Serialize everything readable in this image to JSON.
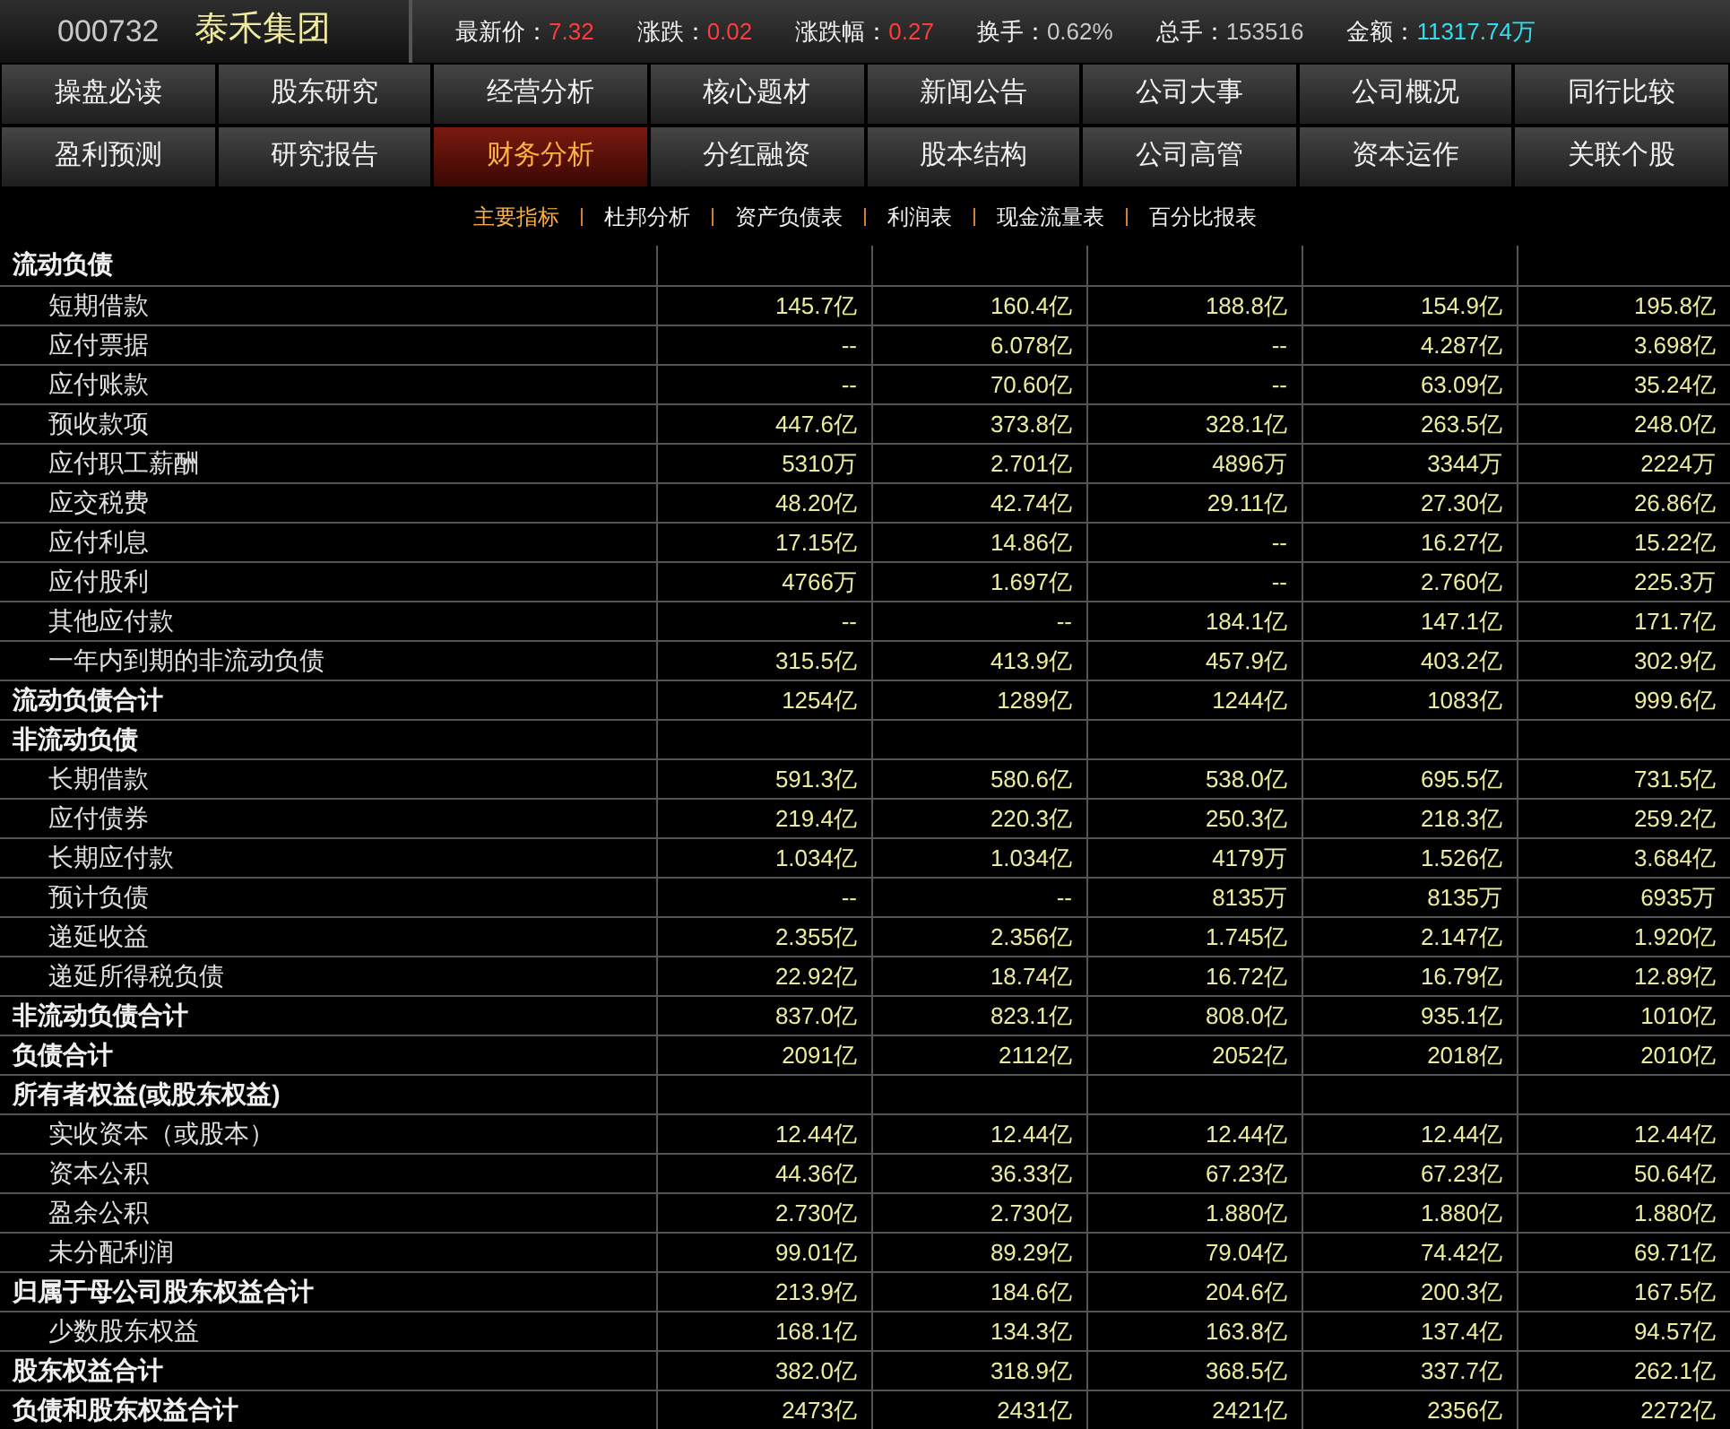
{
  "header": {
    "code": "000732",
    "name": "泰禾集团",
    "stats": [
      {
        "label": "最新价：",
        "value": "7.32",
        "color": "#ff3b3b"
      },
      {
        "label": "涨跌：",
        "value": "0.02",
        "color": "#ff3b3b"
      },
      {
        "label": "涨跌幅：",
        "value": "0.27",
        "color": "#ff3b3b"
      },
      {
        "label": "换手：",
        "value": "0.62%",
        "color": "#c8c8c8"
      },
      {
        "label": "总手：",
        "value": "153516",
        "color": "#c8c8c8"
      },
      {
        "label": "金额：",
        "value": "11317.74万",
        "color": "#33ddee"
      }
    ]
  },
  "nav_rows": [
    [
      {
        "label": "操盘必读",
        "selected": false
      },
      {
        "label": "股东研究",
        "selected": false
      },
      {
        "label": "经营分析",
        "selected": false
      },
      {
        "label": "核心题材",
        "selected": false
      },
      {
        "label": "新闻公告",
        "selected": false
      },
      {
        "label": "公司大事",
        "selected": false
      },
      {
        "label": "公司概况",
        "selected": false
      },
      {
        "label": "同行比较",
        "selected": false
      }
    ],
    [
      {
        "label": "盈利预测",
        "selected": false
      },
      {
        "label": "研究报告",
        "selected": false
      },
      {
        "label": "财务分析",
        "selected": true
      },
      {
        "label": "分红融资",
        "selected": false
      },
      {
        "label": "股本结构",
        "selected": false
      },
      {
        "label": "公司高管",
        "selected": false
      },
      {
        "label": "资本运作",
        "selected": false
      },
      {
        "label": "关联个股",
        "selected": false
      }
    ]
  ],
  "sub_tabs": [
    {
      "label": "主要指标",
      "selected": true
    },
    {
      "label": "杜邦分析",
      "selected": false
    },
    {
      "label": "资产负债表",
      "selected": false
    },
    {
      "label": "利润表",
      "selected": false
    },
    {
      "label": "现金流量表",
      "selected": false
    },
    {
      "label": "百分比报表",
      "selected": false
    }
  ],
  "table": {
    "rows": [
      {
        "kind": "section",
        "label": "流动负债"
      },
      {
        "kind": "item",
        "label": "短期借款",
        "values": [
          "145.7亿",
          "160.4亿",
          "188.8亿",
          "154.9亿",
          "195.8亿"
        ]
      },
      {
        "kind": "item",
        "label": "应付票据",
        "values": [
          "--",
          "6.078亿",
          "--",
          "4.287亿",
          "3.698亿"
        ]
      },
      {
        "kind": "item",
        "label": "应付账款",
        "values": [
          "--",
          "70.60亿",
          "--",
          "63.09亿",
          "35.24亿"
        ]
      },
      {
        "kind": "item",
        "label": "预收款项",
        "values": [
          "447.6亿",
          "373.8亿",
          "328.1亿",
          "263.5亿",
          "248.0亿"
        ]
      },
      {
        "kind": "item",
        "label": "应付职工薪酬",
        "values": [
          "5310万",
          "2.701亿",
          "4896万",
          "3344万",
          "2224万"
        ]
      },
      {
        "kind": "item",
        "label": "应交税费",
        "values": [
          "48.20亿",
          "42.74亿",
          "29.11亿",
          "27.30亿",
          "26.86亿"
        ]
      },
      {
        "kind": "item",
        "label": "应付利息",
        "values": [
          "17.15亿",
          "14.86亿",
          "--",
          "16.27亿",
          "15.22亿"
        ]
      },
      {
        "kind": "item",
        "label": "应付股利",
        "values": [
          "4766万",
          "1.697亿",
          "--",
          "2.760亿",
          "225.3万"
        ]
      },
      {
        "kind": "item",
        "label": "其他应付款",
        "values": [
          "--",
          "--",
          "184.1亿",
          "147.1亿",
          "171.7亿"
        ]
      },
      {
        "kind": "item",
        "label": "一年内到期的非流动负债",
        "values": [
          "315.5亿",
          "413.9亿",
          "457.9亿",
          "403.2亿",
          "302.9亿"
        ]
      },
      {
        "kind": "total",
        "label": "流动负债合计",
        "values": [
          "1254亿",
          "1289亿",
          "1244亿",
          "1083亿",
          "999.6亿"
        ]
      },
      {
        "kind": "section",
        "label": "非流动负债"
      },
      {
        "kind": "item",
        "label": "长期借款",
        "values": [
          "591.3亿",
          "580.6亿",
          "538.0亿",
          "695.5亿",
          "731.5亿"
        ]
      },
      {
        "kind": "item",
        "label": "应付债券",
        "values": [
          "219.4亿",
          "220.3亿",
          "250.3亿",
          "218.3亿",
          "259.2亿"
        ]
      },
      {
        "kind": "item",
        "label": "长期应付款",
        "values": [
          "1.034亿",
          "1.034亿",
          "4179万",
          "1.526亿",
          "3.684亿"
        ]
      },
      {
        "kind": "item",
        "label": "预计负债",
        "values": [
          "--",
          "--",
          "8135万",
          "8135万",
          "6935万"
        ]
      },
      {
        "kind": "item",
        "label": "递延收益",
        "values": [
          "2.355亿",
          "2.356亿",
          "1.745亿",
          "2.147亿",
          "1.920亿"
        ]
      },
      {
        "kind": "item",
        "label": "递延所得税负债",
        "values": [
          "22.92亿",
          "18.74亿",
          "16.72亿",
          "16.79亿",
          "12.89亿"
        ]
      },
      {
        "kind": "total",
        "label": "非流动负债合计",
        "values": [
          "837.0亿",
          "823.1亿",
          "808.0亿",
          "935.1亿",
          "1010亿"
        ]
      },
      {
        "kind": "total",
        "label": "负债合计",
        "values": [
          "2091亿",
          "2112亿",
          "2052亿",
          "2018亿",
          "2010亿"
        ]
      },
      {
        "kind": "section",
        "label": "所有者权益(或股东权益)"
      },
      {
        "kind": "item",
        "label": "实收资本（或股本）",
        "values": [
          "12.44亿",
          "12.44亿",
          "12.44亿",
          "12.44亿",
          "12.44亿"
        ]
      },
      {
        "kind": "item",
        "label": "资本公积",
        "values": [
          "44.36亿",
          "36.33亿",
          "67.23亿",
          "67.23亿",
          "50.64亿"
        ]
      },
      {
        "kind": "item",
        "label": "盈余公积",
        "values": [
          "2.730亿",
          "2.730亿",
          "1.880亿",
          "1.880亿",
          "1.880亿"
        ]
      },
      {
        "kind": "item",
        "label": "未分配利润",
        "values": [
          "99.01亿",
          "89.29亿",
          "79.04亿",
          "74.42亿",
          "69.71亿"
        ]
      },
      {
        "kind": "total",
        "label": "归属于母公司股东权益合计",
        "values": [
          "213.9亿",
          "184.6亿",
          "204.6亿",
          "200.3亿",
          "167.5亿"
        ]
      },
      {
        "kind": "item",
        "label": "少数股东权益",
        "values": [
          "168.1亿",
          "134.3亿",
          "163.8亿",
          "137.4亿",
          "94.57亿"
        ]
      },
      {
        "kind": "total",
        "label": "股东权益合计",
        "values": [
          "382.0亿",
          "318.9亿",
          "368.5亿",
          "337.7亿",
          "262.1亿"
        ]
      },
      {
        "kind": "total",
        "label": "负债和股东权益合计",
        "values": [
          "2473亿",
          "2431亿",
          "2421亿",
          "2356亿",
          "2272亿"
        ]
      }
    ]
  }
}
